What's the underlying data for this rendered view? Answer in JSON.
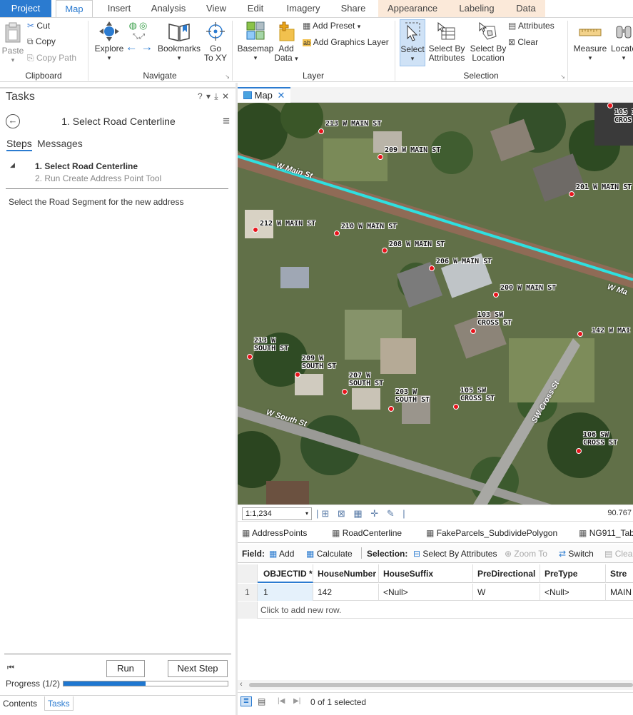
{
  "ribbon_tabs": {
    "project": "Project",
    "map": "Map",
    "insert": "Insert",
    "analysis": "Analysis",
    "view": "View",
    "edit": "Edit",
    "imagery": "Imagery",
    "share": "Share",
    "appearance": "Appearance",
    "labeling": "Labeling",
    "data": "Data"
  },
  "clipboard": {
    "paste": "Paste",
    "cut": "Cut",
    "copy": "Copy",
    "copy_path": "Copy Path",
    "label": "Clipboard"
  },
  "navigate": {
    "explore": "Explore",
    "bookmarks": "Bookmarks",
    "go_to_xy_line1": "Go",
    "go_to_xy_line2": "To XY",
    "label": "Navigate"
  },
  "layer": {
    "basemap": "Basemap",
    "add_data_line1": "Add",
    "add_data_line2": "Data",
    "add_preset": "Add Preset",
    "add_graphics_layer": "Add Graphics Layer",
    "label": "Layer"
  },
  "selection": {
    "select": "Select",
    "select_by_attributes_line1": "Select By",
    "select_by_attributes_line2": "Attributes",
    "select_by_location_line1": "Select By",
    "select_by_location_line2": "Location",
    "attributes": "Attributes",
    "clear": "Clear",
    "label": "Selection"
  },
  "inquiry": {
    "measure": "Measure",
    "locate": "Locate"
  },
  "tasks_pane": {
    "title": "Tasks",
    "header_controls": "? ▾ ⤓ ✕",
    "task_name": "1. Select Road Centerline",
    "steps_tab": "Steps",
    "messages_tab": "Messages",
    "steps": [
      {
        "label": "1.  Select Road Centerline",
        "current": true
      },
      {
        "label": "2.  Run Create Address Point Tool",
        "current": false
      }
    ],
    "instruction": "Select the Road Segment for the new address",
    "run_button": "Run",
    "next_step_button": "Next Step",
    "progress_label": "Progress (1/2)",
    "progress_value": 0.5
  },
  "bottom_tabs": {
    "contents": "Contents",
    "tasks": "Tasks"
  },
  "map_view": {
    "tab_label": "Map",
    "scale": "1:1,234",
    "coordinate": "90.767",
    "roads": [
      "W Main St",
      "W Ma",
      "W South St",
      "SW Cross St"
    ],
    "addresses": [
      "213 W MAIN ST",
      "209 W MAIN ST",
      "105 I\nCROS",
      "201 W MAIN ST",
      "212 W MAIN ST",
      "210 W MAIN ST",
      "208 W MAIN ST",
      "206 W MAIN ST",
      "200 W MAIN ST",
      "103 SW\nCROSS ST",
      "142 W MAI",
      "213 W\nSOUTH ST",
      "209 W\nSOUTH ST",
      "207 W\nSOUTH ST",
      "203 W\nSOUTH ST",
      "105 SW\nCROSS ST",
      "106 SW\nCROSS ST"
    ]
  },
  "table_tabs": [
    "AddressPoints",
    "RoadCenterline",
    "FakeParcels_SubdividePolygon",
    "NG911_Tab"
  ],
  "table_toolbar": {
    "field_label": "Field:",
    "add": "Add",
    "calculate": "Calculate",
    "selection_label": "Selection:",
    "select_by_attributes": "Select By Attributes",
    "zoom_to": "Zoom To",
    "switch": "Switch",
    "clear": "Clea"
  },
  "table": {
    "columns": [
      "OBJECTID *",
      "HouseNumber",
      "HouseSuffix",
      "PreDirectional",
      "PreType",
      "Stre"
    ],
    "rows": [
      {
        "row_number": "1",
        "cells": [
          "1",
          "142",
          "<Null>",
          "W",
          "<Null>",
          "MAIN"
        ]
      }
    ],
    "add_row_hint": "Click to add new row."
  },
  "status": {
    "selection_count": "0 of 1 selected"
  },
  "colors": {
    "accent": "#2b7bd0",
    "contextual_tab": "#fbe9d9",
    "selected_road": "#2fe0e0",
    "address_point": "#e8141c"
  }
}
